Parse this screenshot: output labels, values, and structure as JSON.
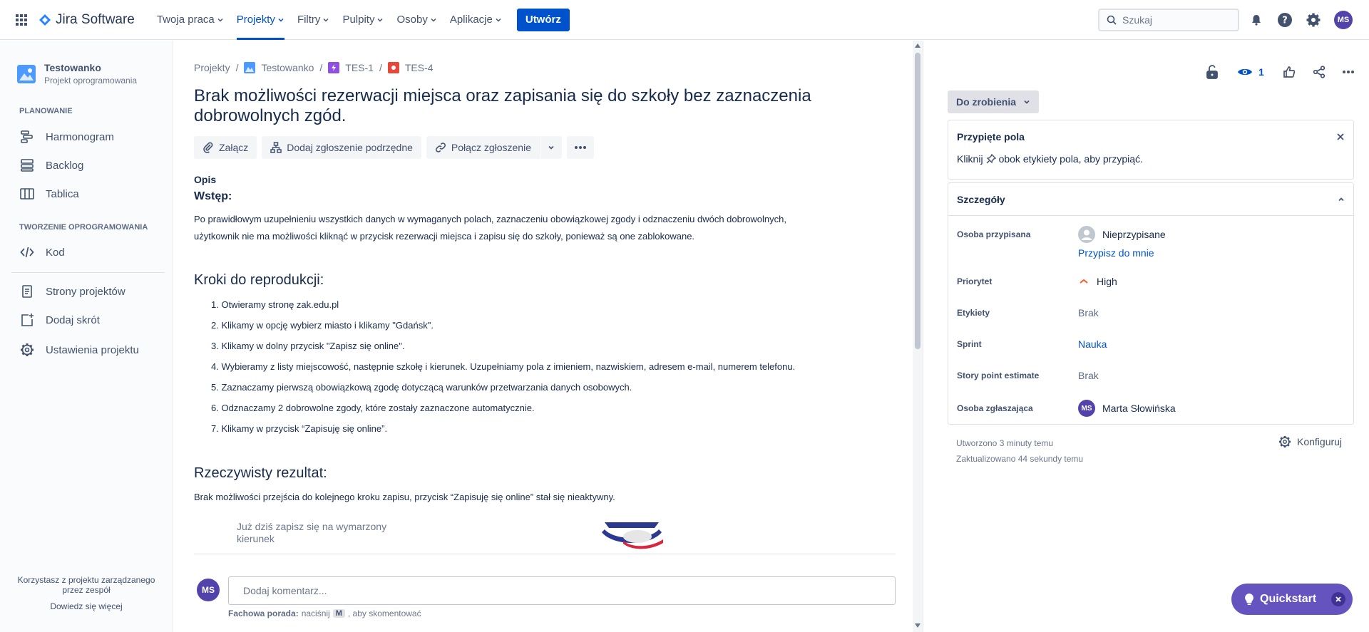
{
  "topnav": {
    "logo_text": "Jira Software",
    "menu": [
      {
        "label": "Twoja praca"
      },
      {
        "label": "Projekty"
      },
      {
        "label": "Filtry"
      },
      {
        "label": "Pulpity"
      },
      {
        "label": "Osoby"
      },
      {
        "label": "Aplikacje"
      }
    ],
    "create_label": "Utwórz",
    "search_placeholder": "Szukaj",
    "avatar_initials": "MS"
  },
  "sidebar": {
    "project_name": "Testowanko",
    "project_type": "Projekt oprogramowania",
    "section_planning": "PLANOWANIE",
    "planning_items": [
      {
        "label": "Harmonogram"
      },
      {
        "label": "Backlog"
      },
      {
        "label": "Tablica"
      }
    ],
    "section_dev": "TWORZENIE OPROGRAMOWANIA",
    "dev_items": [
      {
        "label": "Kod"
      }
    ],
    "bottom_items": [
      {
        "label": "Strony projektów"
      },
      {
        "label": "Dodaj skrót"
      },
      {
        "label": "Ustawienia projektu"
      }
    ],
    "footer_line1": "Korzystasz z projektu zarządzanego",
    "footer_line2": "przez zespół",
    "footer_link": "Dowiedz się więcej"
  },
  "issue": {
    "breadcrumbs": {
      "projects": "Projekty",
      "project": "Testowanko",
      "parent": "TES-1",
      "key": "TES-4"
    },
    "title": "Brak możliwości rezerwacji miejsca oraz zapisania się do szkoły bez zaznaczenia dobrowolnych zgód.",
    "toolbar": {
      "attach": "Załącz",
      "add_child": "Dodaj zgłoszenie podrzędne",
      "link": "Połącz zgłoszenie"
    },
    "description_label": "Opis",
    "intro_heading": "Wstęp:",
    "intro_line1": "Po prawidłowym uzupełnieniu wszystkich danych w wymaganych polach, zaznaczeniu obowiązkowej zgody i odznaczeniu dwóch dobrowolnych,",
    "intro_line2": "użytkownik nie ma możliwości kliknąć w przycisk rezerwacji miejsca i zapisu się do szkoły, ponieważ są one zablokowane.",
    "steps_heading": "Kroki do reprodukcji:",
    "steps": [
      "1. Otwieramy stronę zak.edu.pl",
      "2. Klikamy w opcję wybierz miasto i klikamy \"Gdańsk\".",
      "3. Klikamy w dolny przycisk \"Zapisz się online\".",
      "4. Wybieramy z listy miejscowość, następnie szkołę i kierunek. Uzupełniamy pola z imieniem, nazwiskiem, adresem e-mail, numerem telefonu.",
      "5. Zaznaczamy pierwszą obowiązkową zgodę dotyczącą warunków przetwarzania danych osobowych.",
      "6. Odznaczamy 2 dobrowolne zgody, które zostały zaznaczone automatycznie.",
      "7. Klikamy w przycisk “Zapisuję się online”."
    ],
    "actual_heading": "Rzeczywisty rezultat:",
    "actual_text": "Brak możliwości przejścia do kolejnego kroku zapisu, przycisk “Zapisuję się online” stał się nieaktywny.",
    "image_text_line1": "Już dziś zapisz się na wymarzony",
    "image_text_line2": "kierunek",
    "comment_avatar": "MS",
    "comment_placeholder": "Dodaj komentarz...",
    "tip_bold": "Fachowa porada:",
    "tip_pre": "naciśnij",
    "tip_key": "M",
    "tip_post": ", aby skomentować"
  },
  "panel": {
    "watch_count": "1",
    "status": "Do zrobienia",
    "pinned_title": "Przypięte pola",
    "pinned_text_pre": "Kliknij",
    "pinned_text_post": "obok etykiety pola, aby przypiąć.",
    "details_title": "Szczegóły",
    "fields": {
      "assignee_label": "Osoba przypisana",
      "assignee_value": "Nieprzypisane",
      "assign_me": "Przypisz do mnie",
      "priority_label": "Priorytet",
      "priority_value": "High",
      "labels_label": "Etykiety",
      "labels_value": "Brak",
      "sprint_label": "Sprint",
      "sprint_value": "Nauka",
      "spe_label": "Story point estimate",
      "spe_value": "Brak",
      "reporter_label": "Osoba zgłaszająca",
      "reporter_value": "Marta Słowińska",
      "reporter_initials": "MS"
    },
    "created": "Utworzono 3 minuty temu",
    "updated": "Zaktualizowano 44 sekundy temu",
    "configure": "Konfiguruj"
  },
  "quickstart": {
    "label": "Quickstart"
  },
  "colors": {
    "primary": "#0052CC",
    "purple": "#6554C0",
    "priority_high": "#FF5630"
  }
}
